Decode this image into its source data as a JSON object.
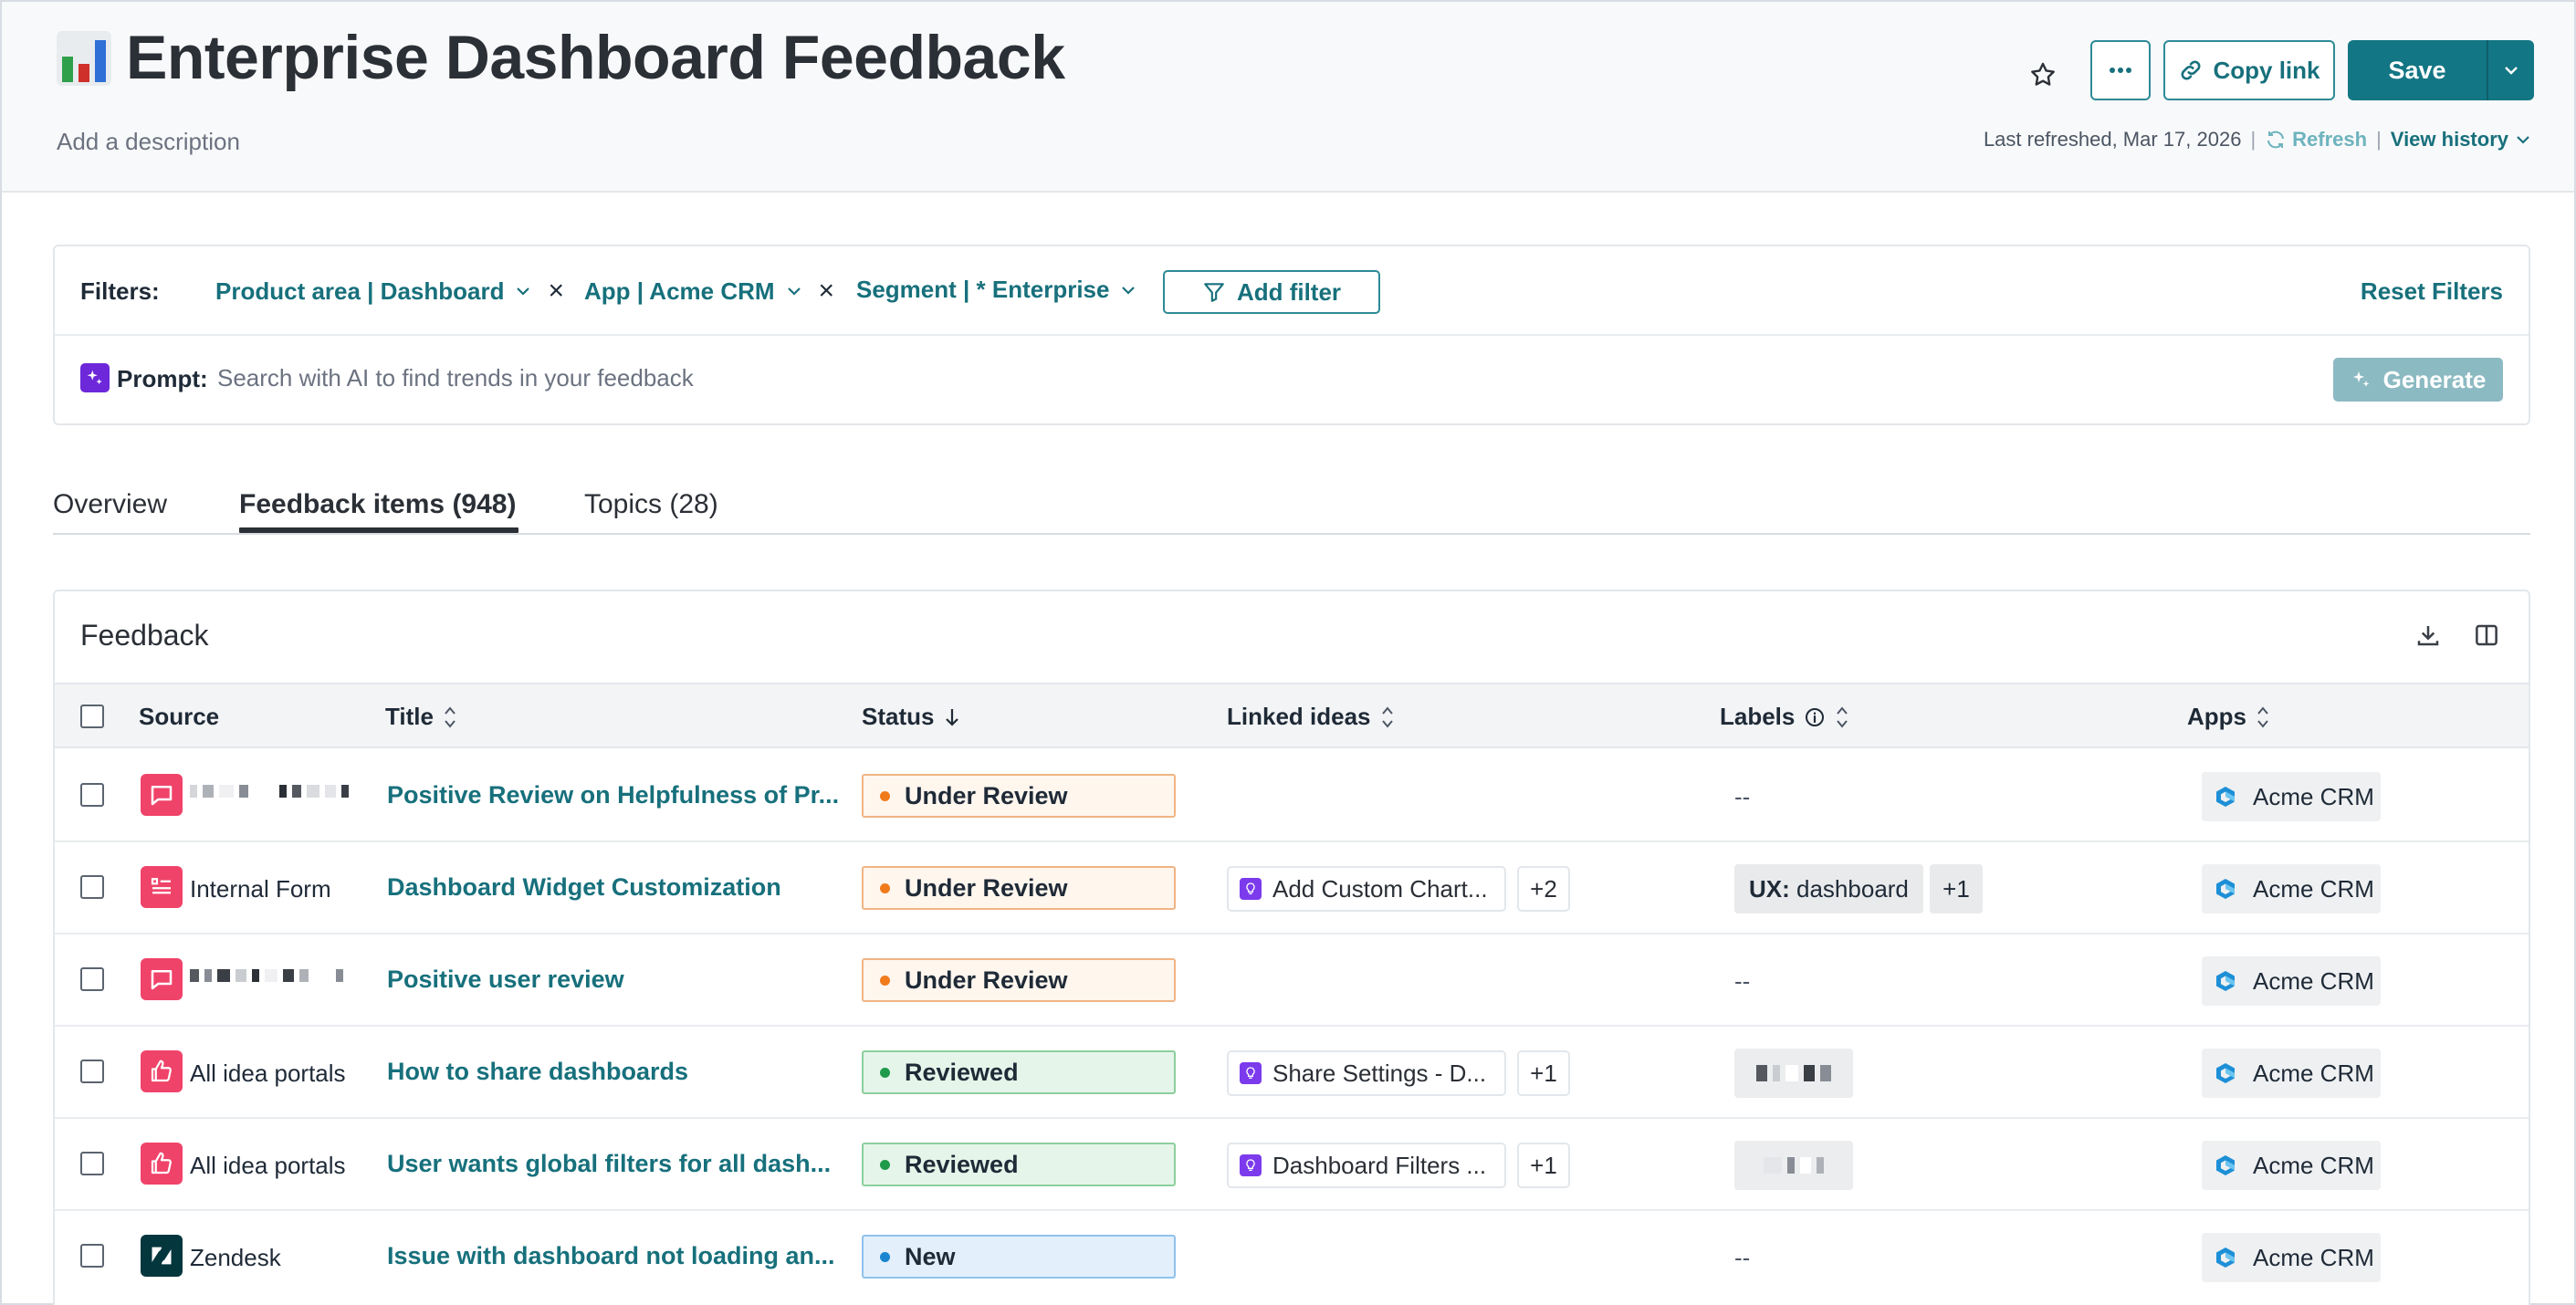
{
  "header": {
    "title": "Enterprise Dashboard Feedback",
    "title_icon": "bar-chart-emoji",
    "description_placeholder": "Add a description",
    "copy_link_label": "Copy link",
    "save_label": "Save",
    "last_refreshed": "Last refreshed, Mar 17, 2026",
    "refresh_label": "Refresh",
    "view_history_label": "View history",
    "separator": "|"
  },
  "filters": {
    "label": "Filters:",
    "chips": [
      {
        "text": "Product area | Dashboard",
        "removable": true
      },
      {
        "text": "App | Acme CRM",
        "removable": true
      },
      {
        "text": "Segment | * Enterprise",
        "removable": false
      }
    ],
    "add_filter_label": "Add filter",
    "reset_label": "Reset Filters",
    "remove_symbol": "×"
  },
  "prompt": {
    "label": "Prompt:",
    "placeholder": "Search with AI to find trends in your feedback",
    "generate_label": "Generate"
  },
  "tabs": [
    {
      "label": "Overview",
      "active": false
    },
    {
      "label": "Feedback items (948)",
      "active": true
    },
    {
      "label": "Topics (28)",
      "active": false
    }
  ],
  "table": {
    "title": "Feedback",
    "columns": [
      "Source",
      "Title",
      "Status",
      "Linked ideas",
      "Labels",
      "Apps"
    ],
    "rows": [
      {
        "source": "",
        "source_type": "review",
        "title": "Positive Review on Helpfulness of Pr...",
        "status": "Under Review",
        "idea": "",
        "idea_more": "",
        "labels": "--",
        "label_more": "",
        "app": "Acme CRM"
      },
      {
        "source": "Internal Form",
        "source_type": "form",
        "title": "Dashboard Widget Customization",
        "status": "Under Review",
        "idea": "Add Custom Chart...",
        "idea_more": "+2",
        "label_key": "UX:",
        "label_value": "dashboard",
        "label_more": "+1",
        "app": "Acme CRM"
      },
      {
        "source": "",
        "source_type": "review",
        "title": "Positive user review",
        "status": "Under Review",
        "idea": "",
        "idea_more": "",
        "labels": "--",
        "label_more": "",
        "app": "Acme CRM"
      },
      {
        "source": "All idea portals",
        "source_type": "portal",
        "title": "How to share dashboards",
        "status": "Reviewed",
        "idea": "Share Settings - D...",
        "idea_more": "+1",
        "labels": "",
        "label_more": "",
        "app": "Acme CRM"
      },
      {
        "source": "All idea portals",
        "source_type": "portal",
        "title": "User wants global filters for all dash...",
        "status": "Reviewed",
        "idea": "Dashboard Filters ...",
        "idea_more": "+1",
        "labels": "",
        "label_more": "",
        "app": "Acme CRM"
      },
      {
        "source": "Zendesk",
        "source_type": "zendesk",
        "title": "Issue with dashboard not loading an...",
        "status": "New",
        "idea": "",
        "idea_more": "",
        "labels": "--",
        "label_more": "",
        "app": "Acme CRM"
      }
    ]
  },
  "colors": {
    "accent": "#17707c",
    "save_bg": "#137684",
    "under_review_bg": "#fff6ee",
    "under_review_border": "#f0b483",
    "under_review_dot": "#f07b1c",
    "reviewed_bg": "#e6f5ea",
    "reviewed_border": "#8ccf9d",
    "reviewed_dot": "#1e9a4a",
    "new_bg": "#e3f0fc",
    "new_border": "#90c2ec",
    "new_dot": "#1a86d0",
    "source_pink": "#f0436a",
    "zendesk": "#03363d"
  }
}
